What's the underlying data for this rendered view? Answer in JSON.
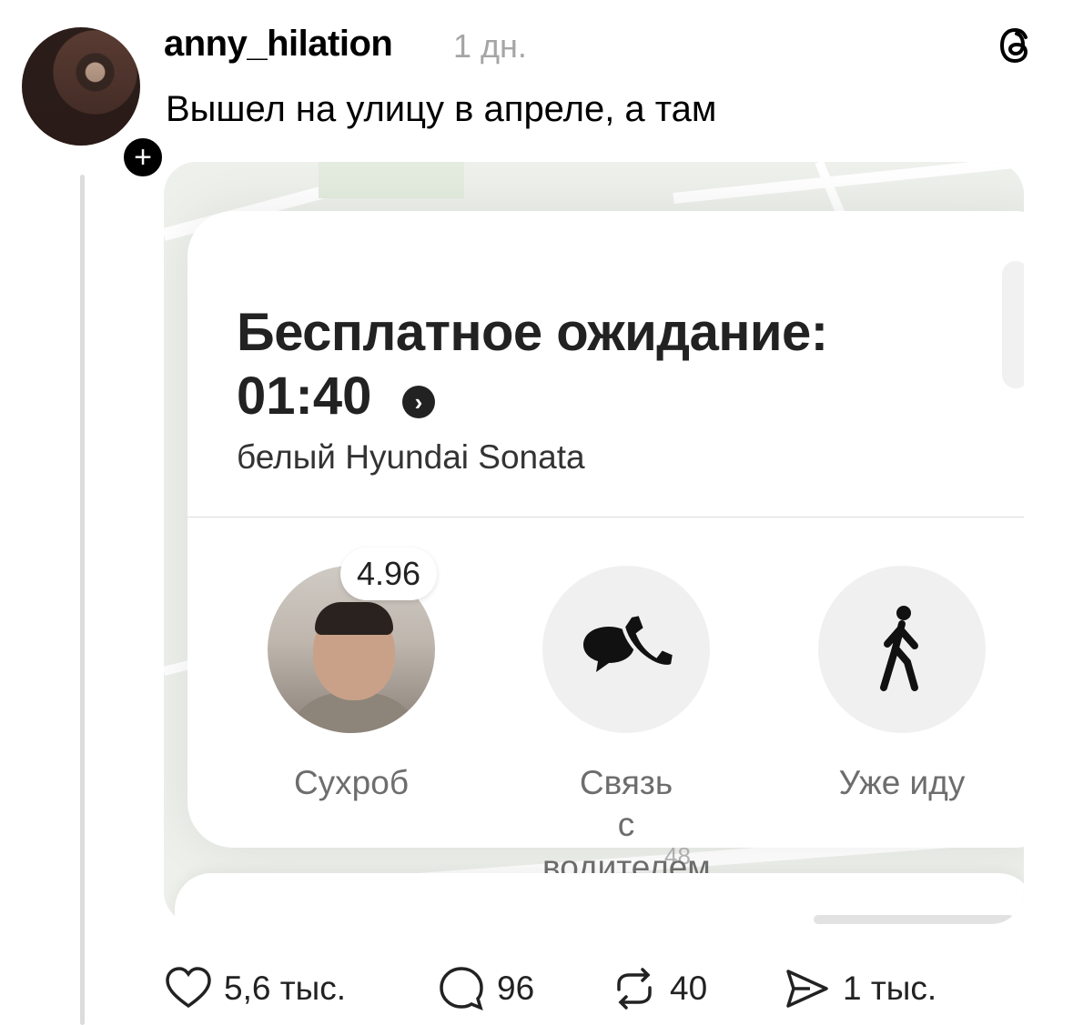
{
  "post": {
    "username": "anny_hilation",
    "time_ago": "1 дн.",
    "text": "Вышел на улицу в апреле, а там",
    "follow_symbol": "+"
  },
  "screenshot": {
    "title": "Бесплатное ожидание:",
    "timer": "01:40",
    "car": "белый Hyundai Sonata",
    "map_label": "48",
    "driver": {
      "rating": "4.96",
      "name": "Сухроб"
    },
    "actions": [
      {
        "label": "Сухроб",
        "icon": "driver-photo"
      },
      {
        "label": "Связь с водителем",
        "label_line1": "Связь",
        "label_line2": "с водителем",
        "icon": "chat-phone-icon"
      },
      {
        "label": "Уже иду",
        "icon": "walking-person-icon"
      }
    ]
  },
  "engagement": {
    "likes": "5,6 тыс.",
    "comments": "96",
    "reposts": "40",
    "shares": "1 тыс."
  }
}
